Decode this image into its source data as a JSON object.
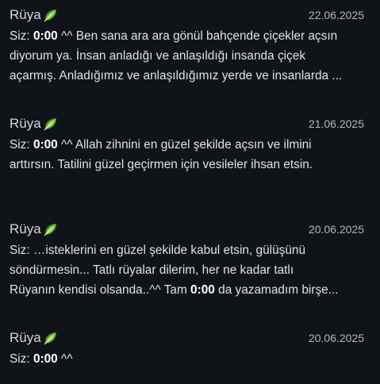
{
  "messages": [
    {
      "sender": "Rüya",
      "date": "22.06.2025",
      "prefix": "Siz:",
      "time": "0:00",
      "line1_after": " ^^ Ben sana ara ara gönül bahçende çiçekler açsın",
      "line2": "diyorum ya.  İnsan anladığı ve anlaşıldığı insanda çiçek",
      "line3": "açarmış. Anladığımız ve anlaşıldığımız yerde ve insanlarda ..."
    },
    {
      "sender": "Rüya",
      "date": "21.06.2025",
      "prefix": "Siz:",
      "time": "0:00",
      "line1_after": " ^^ Allah zihnini en güzel şekilde açsın ve ilmini",
      "line2": "arttırsın.  Tatilini güzel geçirmen için vesileler ihsan etsin."
    },
    {
      "sender": "Rüya",
      "date": "20.06.2025",
      "prefix": "Siz:",
      "line1_after": "  …isteklerini en güzel şekilde kabul etsin, gülüşünü",
      "line2": "söndürmesin...  Tatlı rüyalar dilerim, her ne kadar tatlı",
      "line3_before": "Rüyanın kendisi olsanda..^^ Tam ",
      "line3_time": "0:00",
      "line3_after": " da yazamadım birşe..."
    },
    {
      "sender": "Rüya",
      "date": "20.06.2025",
      "prefix": "Siz:",
      "time": "0:00",
      "line1_after": " ^^"
    }
  ],
  "colors": {
    "background": "#101418",
    "leaf_dark": "#3f8f2a",
    "leaf_light": "#8fd14f"
  }
}
